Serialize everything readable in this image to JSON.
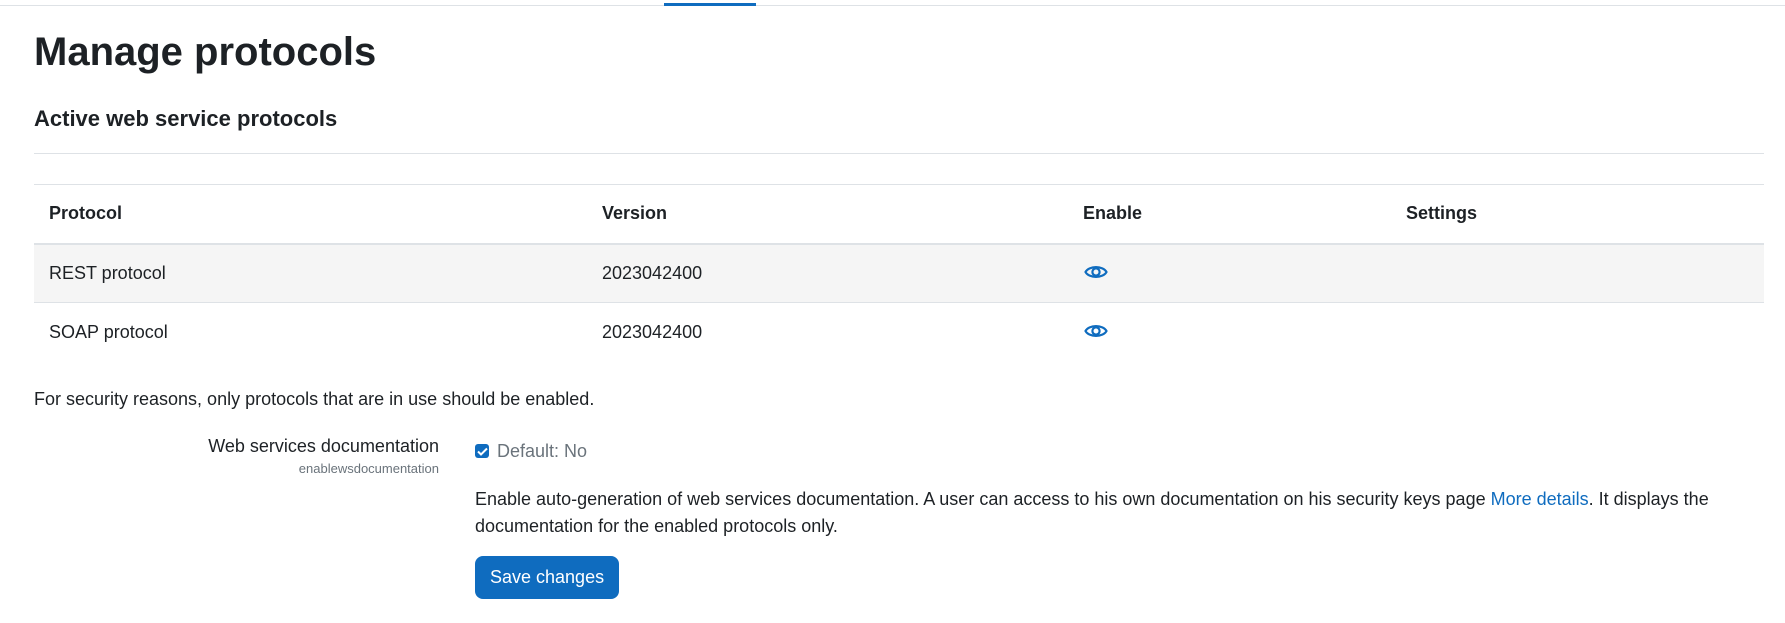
{
  "page": {
    "title": "Manage protocols",
    "section_title": "Active web service protocols"
  },
  "table": {
    "headers": [
      "Protocol",
      "Version",
      "Enable",
      "Settings"
    ],
    "rows": [
      {
        "protocol": "REST protocol",
        "version": "2023042400",
        "enable_icon": "eye-icon"
      },
      {
        "protocol": "SOAP protocol",
        "version": "2023042400",
        "enable_icon": "eye-icon"
      }
    ]
  },
  "security_note": "For security reasons, only protocols that are in use should be enabled.",
  "setting": {
    "label": "Web services documentation",
    "key": "enablewsdocumentation",
    "checked": true,
    "default_text": "Default: No",
    "description_before": "Enable auto-generation of web services documentation. A user can access to his own documentation on his security keys page ",
    "link_text": "More details",
    "description_after": ". It displays the documentation for the enabled protocols only."
  },
  "save_button": "Save changes",
  "colors": {
    "accent": "#0f6cbf",
    "text": "#1d2125",
    "muted": "#6a737b",
    "row_stripe": "#f5f5f5"
  }
}
